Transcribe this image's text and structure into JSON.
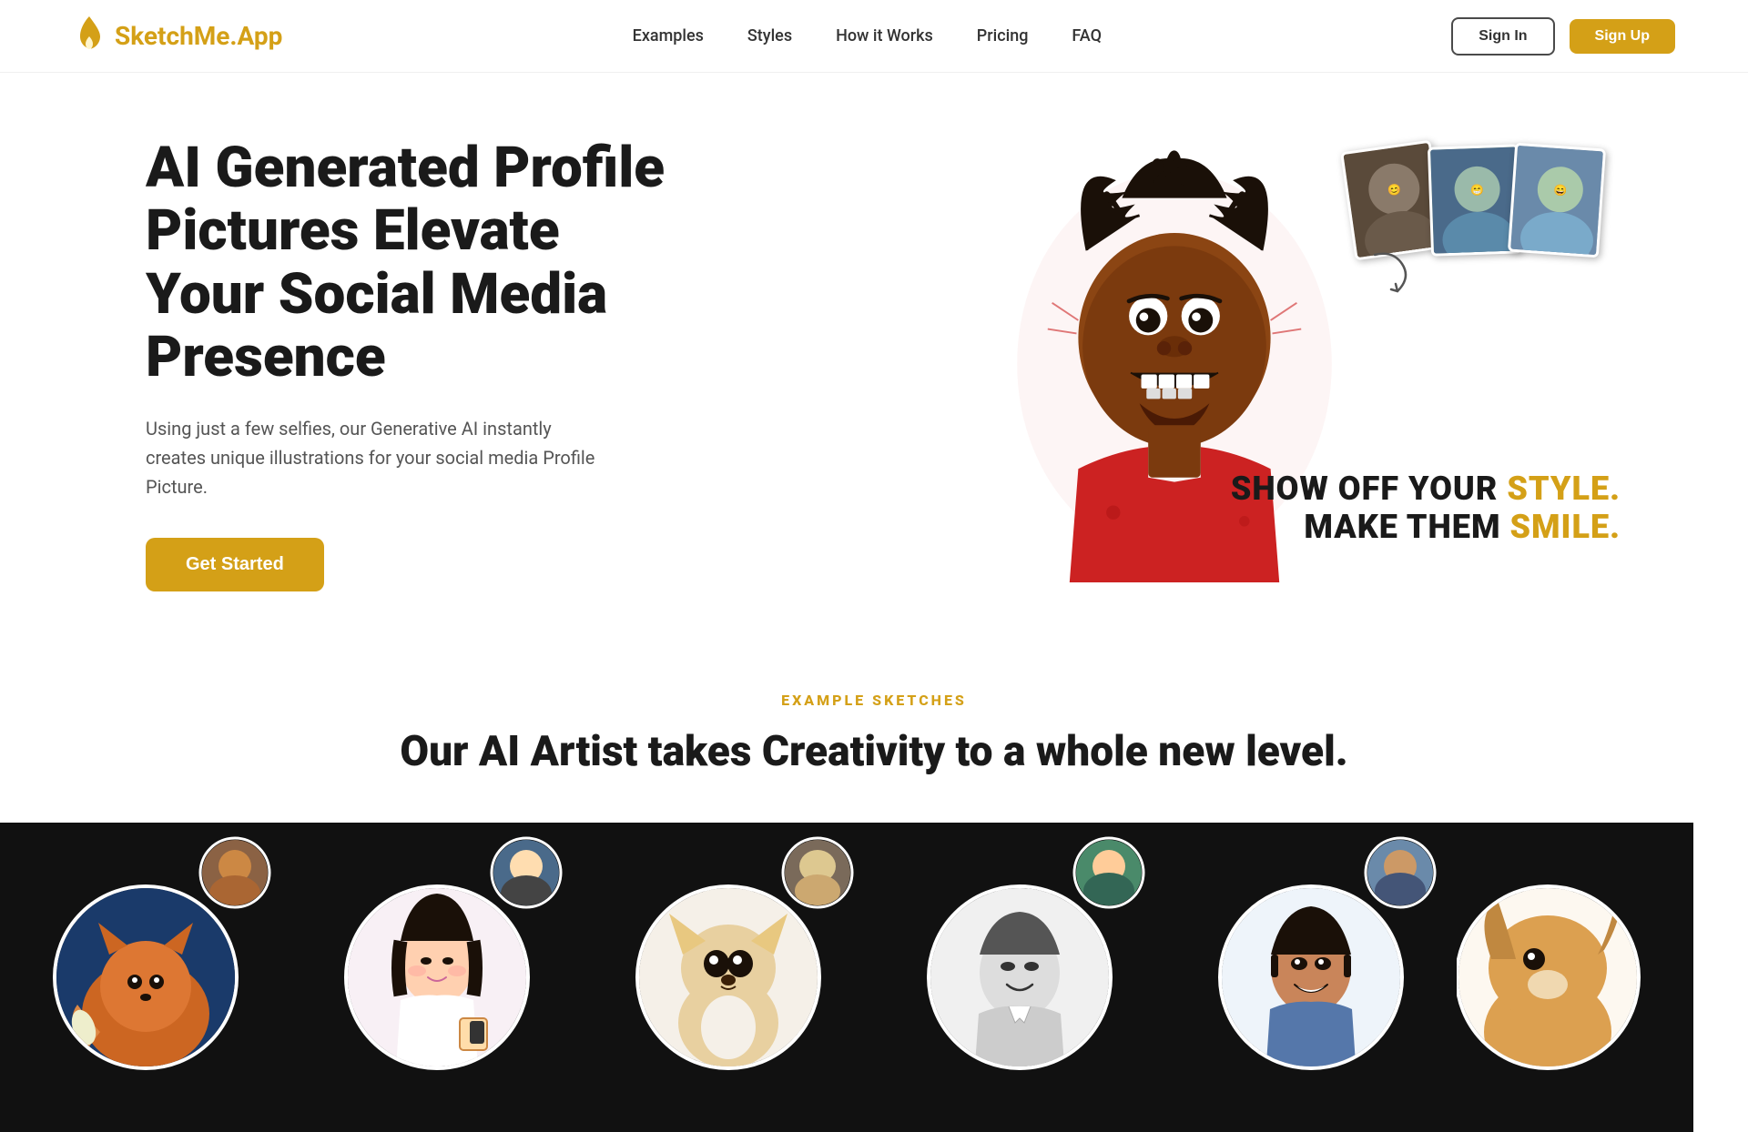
{
  "brand": {
    "name": "SketchMe.App",
    "logo_icon": "flame-icon"
  },
  "navbar": {
    "links": [
      {
        "label": "Examples",
        "href": "#examples"
      },
      {
        "label": "Styles",
        "href": "#styles"
      },
      {
        "label": "How it Works",
        "href": "#how-it-works"
      },
      {
        "label": "Pricing",
        "href": "#pricing"
      },
      {
        "label": "FAQ",
        "href": "#faq"
      }
    ],
    "signin_label": "Sign In",
    "signup_label": "Sign Up"
  },
  "hero": {
    "title": "AI Generated Profile Pictures Elevate Your Social Media Presence",
    "subtitle": "Using just a few selfies, our Generative AI instantly creates unique illustrations for your social media Profile Picture.",
    "cta_label": "Get Started",
    "tagline_line1": "SHOW OFF YOUR STYLE.",
    "tagline_line2": "MAKE THEM SMILE.",
    "tagline_highlight1": "STYLE.",
    "tagline_highlight2": "SMILE."
  },
  "examples_section": {
    "eyebrow": "EXAMPLE SKETCHES",
    "title": "Our AI Artist takes Creativity to a whole new level.",
    "items": [
      {
        "id": 1,
        "alt": "Fox illustration sketch"
      },
      {
        "id": 2,
        "alt": "Asian woman illustration"
      },
      {
        "id": 3,
        "alt": "Chihuahua dog illustration"
      },
      {
        "id": 4,
        "alt": "Asian man illustration"
      },
      {
        "id": 5,
        "alt": "Indian man illustration"
      },
      {
        "id": 6,
        "alt": "Dog illustration partial"
      }
    ]
  },
  "colors": {
    "primary": "#D4A017",
    "dark": "#1a1a1a",
    "text": "#333333",
    "muted": "#555555"
  }
}
